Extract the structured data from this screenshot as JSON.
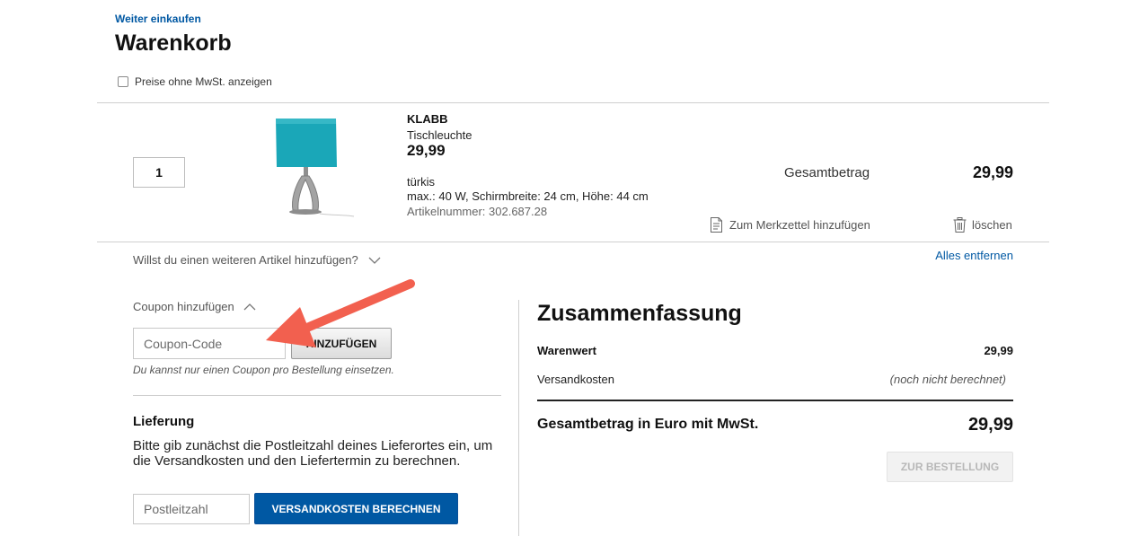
{
  "header": {
    "continue_shopping": "Weiter einkaufen",
    "title": "Warenkorb",
    "vat_toggle_label": "Preise ohne MwSt. anzeigen"
  },
  "cart_item": {
    "quantity": "1",
    "name": "KLABB",
    "type": "Tischleuchte",
    "price": "29,99",
    "color": "türkis",
    "specs": "max.: 40 W, Schirmbreite: 24 cm, Höhe: 44 cm",
    "article_number": "Artikelnummer: 302.687.28",
    "total_label": "Gesamtbetrag",
    "total_value": "29,99",
    "wishlist_label": "Zum Merkzettel hinzufügen",
    "delete_label": "löschen",
    "image_icon": "table-lamp-image",
    "colors": {
      "shade": "#1aa7b8",
      "base": "#9a9a9a"
    }
  },
  "add_more": {
    "label": "Willst du einen weiteren Artikel hinzufügen?"
  },
  "remove_all": {
    "label": "Alles entfernen"
  },
  "coupon": {
    "toggle_label": "Coupon hinzufügen",
    "placeholder": "Coupon-Code",
    "button_label": "HINZUFÜGEN",
    "note": "Du kannst nur einen Coupon pro Bestellung einsetzen."
  },
  "delivery": {
    "title": "Lieferung",
    "text": "Bitte gib zunächst die Postleitzahl deines Lieferortes ein, um die Versandkosten und den Liefertermin zu berechnen.",
    "zip_placeholder": "Postleitzahl",
    "calc_button_label": "VERSANDKOSTEN BERECHNEN"
  },
  "summary": {
    "title": "Zusammenfassung",
    "goods_label": "Warenwert",
    "goods_value": "29,99",
    "shipping_label": "Versandkosten",
    "shipping_value": "(noch nicht berechnet)",
    "grand_total_label": "Gesamtbetrag in Euro mit MwSt.",
    "grand_total_value": "29,99",
    "order_button_label": "ZUR BESTELLUNG"
  },
  "colors": {
    "link": "#0058a3",
    "primary_button": "#0058a3",
    "annotation_arrow": "#f2604f"
  }
}
